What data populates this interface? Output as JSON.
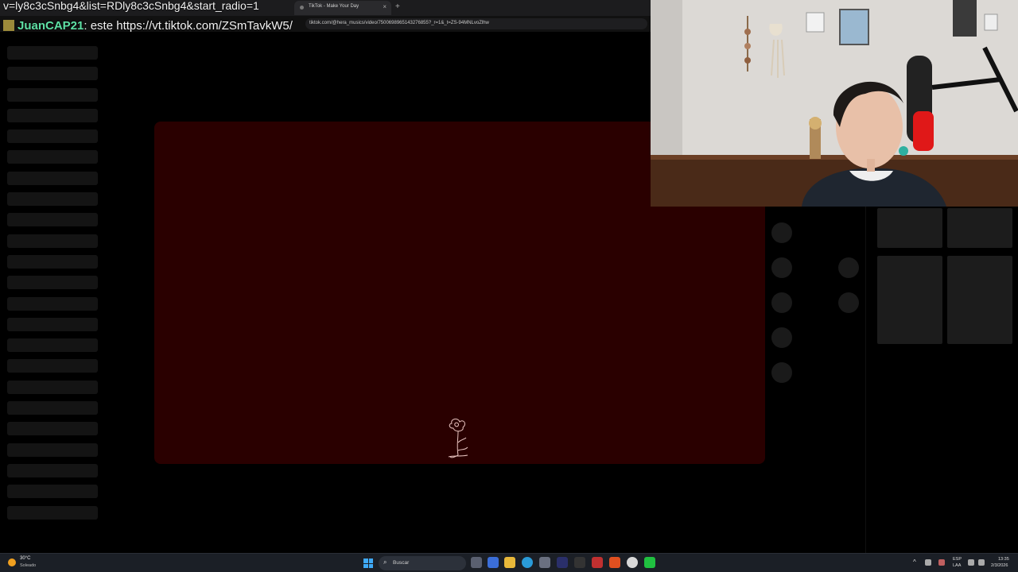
{
  "overlay": {
    "url_fragment": "v=ly8c3cSnbg4&list=RDly8c3cSnbg4&start_radio=1",
    "chat_user": "JuanCAP21",
    "chat_message": ": este https://vt.tiktok.com/ZSmTavkW5/"
  },
  "browser": {
    "tab_title": "TikTok - Make Your Day",
    "tab_close": "×",
    "new_tab": "+",
    "address": "tiktok.com/@hera_musics/video/7500698965143276855?_r=1&_t=ZS-94MNLvoZlhw"
  },
  "taskbar": {
    "weather_temp": "30°C",
    "weather_desc": "Soleado",
    "search_placeholder": "Buscar",
    "search_icon": "⌕",
    "lang_top": "ESP",
    "lang_bottom": "LAA",
    "time": "13:35",
    "date": "2/3/2026"
  },
  "colors": {
    "video_bg": "#2a0000",
    "chat_user": "#5ee0a5"
  }
}
